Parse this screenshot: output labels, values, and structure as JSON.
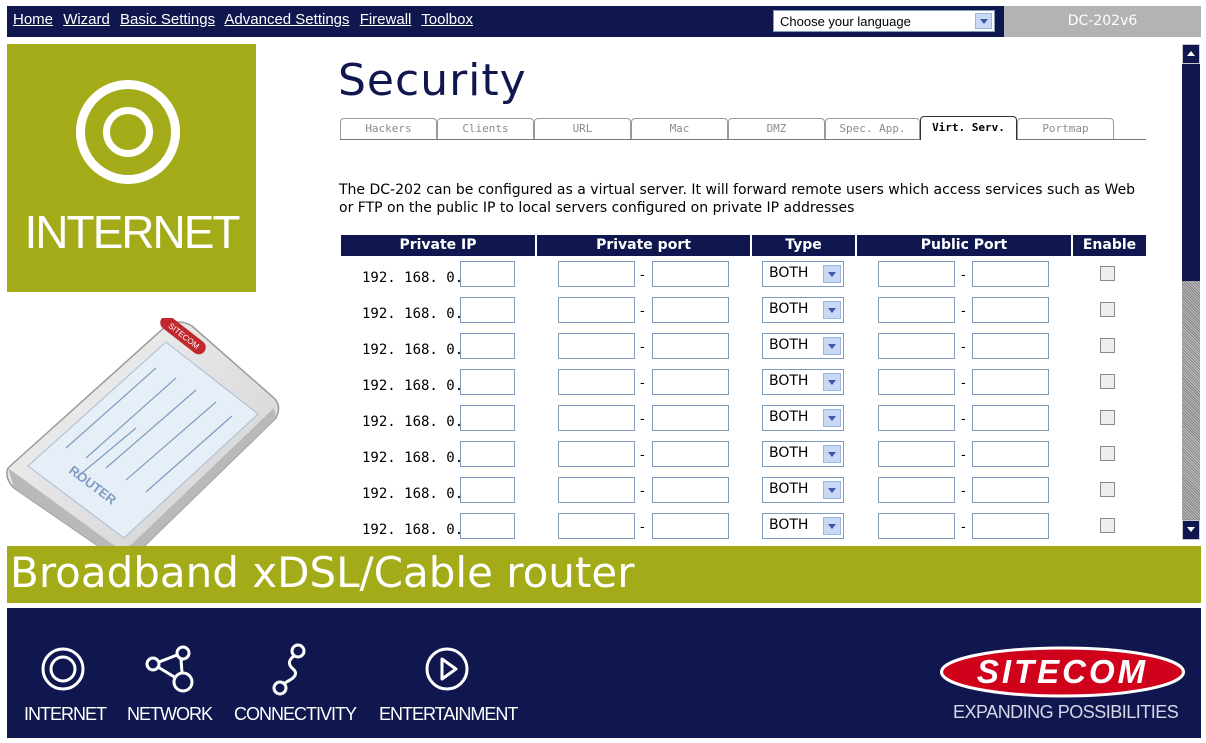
{
  "nav": {
    "items": [
      {
        "label": "Home"
      },
      {
        "label": "Wizard"
      },
      {
        "label": "Basic Settings"
      },
      {
        "label": "Advanced Settings"
      },
      {
        "label": "Firewall"
      },
      {
        "label": "Toolbox"
      }
    ]
  },
  "language": {
    "selected": "Choose your language"
  },
  "model": "DC-202v6",
  "sidebar": {
    "section_label": "INTERNET",
    "icon": "internet-icon",
    "router_label": "ROUTER",
    "router_brand": "SITECOM"
  },
  "page": {
    "title": "Security",
    "tabs": [
      {
        "label": "Hackers",
        "active": false
      },
      {
        "label": "Clients",
        "active": false
      },
      {
        "label": "URL",
        "active": false
      },
      {
        "label": "Mac",
        "active": false
      },
      {
        "label": "DMZ",
        "active": false
      },
      {
        "label": "Spec. App.",
        "active": false
      },
      {
        "label": "Virt. Serv.",
        "active": true
      },
      {
        "label": "Portmap",
        "active": false
      }
    ],
    "description": "The DC-202 can be configured as a virtual server. It will forward remote users which access services such as Web or FTP on the public IP to local servers configured on private IP addresses"
  },
  "table": {
    "headers": [
      "Private IP",
      "Private port",
      "Type",
      "Public Port",
      "Enable"
    ],
    "rows": [
      {
        "ip_prefix": "192. 168. 0.",
        "type": "BOTH",
        "enabled": false
      },
      {
        "ip_prefix": "192. 168. 0.",
        "type": "BOTH",
        "enabled": false
      },
      {
        "ip_prefix": "192. 168. 0.",
        "type": "BOTH",
        "enabled": false
      },
      {
        "ip_prefix": "192. 168. 0.",
        "type": "BOTH",
        "enabled": false
      },
      {
        "ip_prefix": "192. 168. 0.",
        "type": "BOTH",
        "enabled": false
      },
      {
        "ip_prefix": "192. 168. 0.",
        "type": "BOTH",
        "enabled": false
      },
      {
        "ip_prefix": "192. 168. 0.",
        "type": "BOTH",
        "enabled": false
      },
      {
        "ip_prefix": "192. 168. 0.",
        "type": "BOTH",
        "enabled": false
      }
    ],
    "range_separator": "-"
  },
  "banner": {
    "text": "Broadband xDSL/Cable router"
  },
  "footer": {
    "items": [
      {
        "label": "INTERNET",
        "icon": "internet-icon"
      },
      {
        "label": "NETWORK",
        "icon": "network-icon"
      },
      {
        "label": "CONNECTIVITY",
        "icon": "connectivity-icon"
      },
      {
        "label": "ENTERTAINMENT",
        "icon": "play-icon"
      }
    ],
    "brand": "SITECOM",
    "tagline": "EXPANDING POSSIBILITIES"
  },
  "colors": {
    "navy": "#10174f",
    "olive": "#a4ab19",
    "brand_red": "#d0021b",
    "gray": "#b3b3b3"
  }
}
